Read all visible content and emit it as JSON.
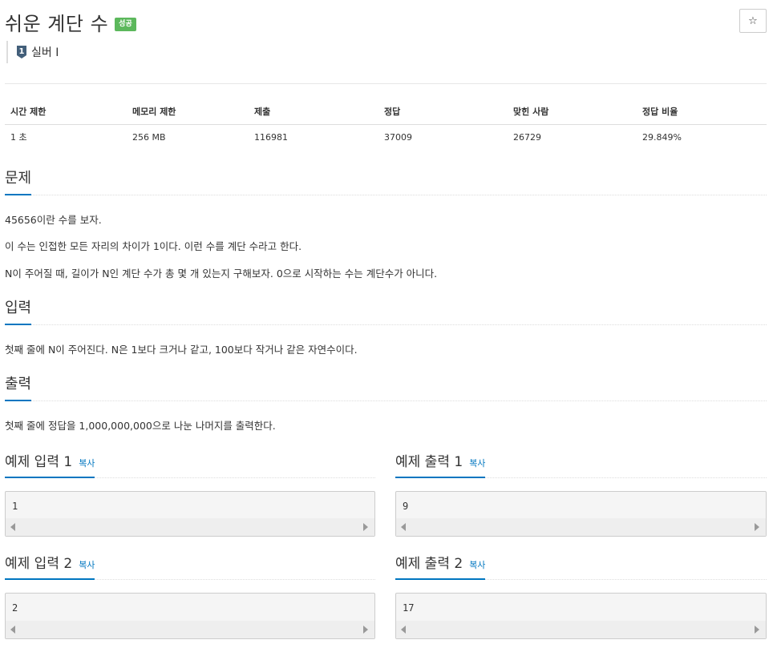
{
  "header": {
    "title": "쉬운 계단 수",
    "badge": "성공",
    "star_icon": "☆",
    "tier_icon": "silver-tier-1-icon",
    "tier_label": "실버 I"
  },
  "colors": {
    "accent": "#0076c0",
    "success": "#5cb85c",
    "tier": "#435f7a"
  },
  "info_table": {
    "headers": [
      "시간 제한",
      "메모리 제한",
      "제출",
      "정답",
      "맞힌 사람",
      "정답 비율"
    ],
    "values": [
      "1 초",
      "256 MB",
      "116981",
      "37009",
      "26729",
      "29.849%"
    ]
  },
  "problem": {
    "heading": "문제",
    "lines": [
      "45656이란 수를 보자.",
      "이 수는 인접한 모든 자리의 차이가 1이다. 이런 수를 계단 수라고 한다.",
      "N이 주어질 때, 길이가 N인 계단 수가 총 몇 개 있는지 구해보자. 0으로 시작하는 수는 계단수가 아니다."
    ]
  },
  "input": {
    "heading": "입력",
    "text": "첫째 줄에 N이 주어진다. N은 1보다 크거나 같고, 100보다 작거나 같은 자연수이다."
  },
  "output": {
    "heading": "출력",
    "text": "첫째 줄에 정답을 1,000,000,000으로 나눈 나머지를 출력한다."
  },
  "examples": {
    "copy_label": "복사",
    "in1_title": "예제 입력 1",
    "in1_value": "1",
    "out1_title": "예제 출력 1",
    "out1_value": "9",
    "in2_title": "예제 입력 2",
    "in2_value": "2",
    "out2_title": "예제 출력 2",
    "out2_value": "17"
  }
}
